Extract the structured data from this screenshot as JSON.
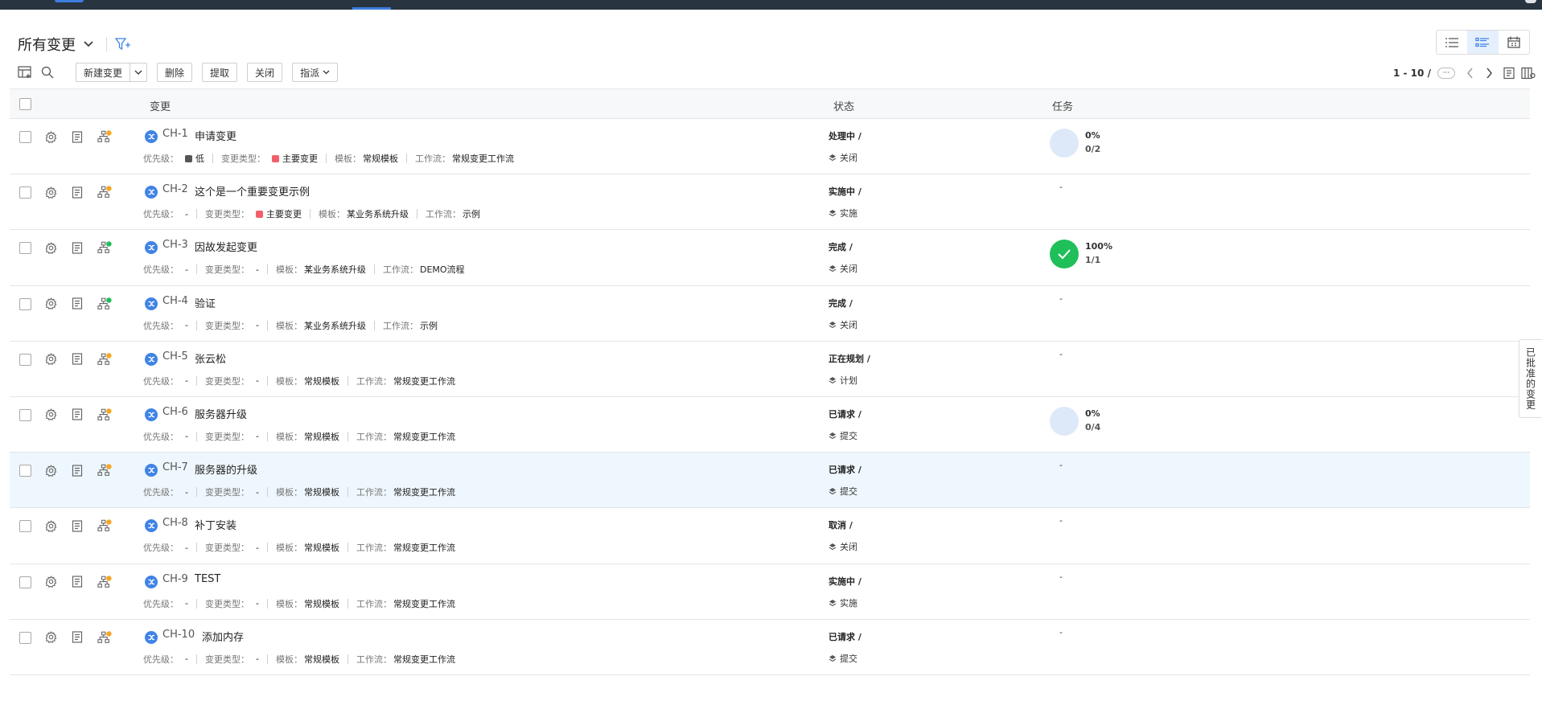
{
  "header": {
    "title": "所有变更"
  },
  "toolbar": {
    "new_label": "新建变更",
    "delete_label": "删除",
    "fetch_label": "提取",
    "close_label": "关闭",
    "assign_label": "指派"
  },
  "pager": {
    "range": "1 - 10 /",
    "more": "···"
  },
  "columns": {
    "change": "变更",
    "status": "状态",
    "task": "任务"
  },
  "labels": {
    "priority": "优先级：",
    "change_type": "变更类型：",
    "template": "模板：",
    "workflow": "工作流："
  },
  "side_tab": {
    "label": "已批准的变更"
  },
  "colors": {
    "accent": "#3f83e6",
    "badge_orange": "#f5a623",
    "badge_green": "#1fbf5a",
    "type_red": "#f0606a",
    "priority_low": "#555555",
    "highlight_row": "#eef7fd"
  },
  "rows": [
    {
      "id": "CH-1",
      "title": "申请变更",
      "priority": "低",
      "priority_color": "#555555",
      "change_type": "主要变更",
      "type_color": "#f0606a",
      "template": "常规模板",
      "workflow": "常规变更工作流",
      "stage": "处理中 /",
      "status": "关闭",
      "task_pct": "0%",
      "task_count": "0/2",
      "task_state": "progress",
      "badge": "orange"
    },
    {
      "id": "CH-2",
      "title": "这个是一个重要变更示例",
      "priority": "-",
      "priority_color": "",
      "change_type": "主要变更",
      "type_color": "#f0606a",
      "template": "某业务系统升级",
      "workflow": "示例",
      "stage": "实施中 /",
      "status": "实施",
      "task_pct": "",
      "task_count": "",
      "task_state": "none",
      "badge": "orange"
    },
    {
      "id": "CH-3",
      "title": "因故发起变更",
      "priority": "-",
      "priority_color": "",
      "change_type": "-",
      "type_color": "",
      "template": "某业务系统升级",
      "workflow": "DEMO流程",
      "stage": "完成 /",
      "status": "关闭",
      "task_pct": "100%",
      "task_count": "1/1",
      "task_state": "done",
      "badge": "green"
    },
    {
      "id": "CH-4",
      "title": "验证",
      "priority": "-",
      "priority_color": "",
      "change_type": "-",
      "type_color": "",
      "template": "某业务系统升级",
      "workflow": "示例",
      "stage": "完成 /",
      "status": "关闭",
      "task_pct": "",
      "task_count": "",
      "task_state": "none",
      "badge": "green"
    },
    {
      "id": "CH-5",
      "title": "张云松",
      "priority": "-",
      "priority_color": "",
      "change_type": "-",
      "type_color": "",
      "template": "常规模板",
      "workflow": "常规变更工作流",
      "stage": "正在规划 /",
      "status": "计划",
      "task_pct": "",
      "task_count": "",
      "task_state": "none",
      "badge": "orange"
    },
    {
      "id": "CH-6",
      "title": "服务器升级",
      "priority": "-",
      "priority_color": "",
      "change_type": "-",
      "type_color": "",
      "template": "常规模板",
      "workflow": "常规变更工作流",
      "stage": "已请求 /",
      "status": "提交",
      "task_pct": "0%",
      "task_count": "0/4",
      "task_state": "progress",
      "badge": "orange"
    },
    {
      "id": "CH-7",
      "title": "服务器的升级",
      "priority": "-",
      "priority_color": "",
      "change_type": "-",
      "type_color": "",
      "template": "常规模板",
      "workflow": "常规变更工作流",
      "stage": "已请求 /",
      "status": "提交",
      "task_pct": "",
      "task_count": "",
      "task_state": "none",
      "badge": "orange"
    },
    {
      "id": "CH-8",
      "title": "补丁安装",
      "priority": "-",
      "priority_color": "",
      "change_type": "-",
      "type_color": "",
      "template": "常规模板",
      "workflow": "常规变更工作流",
      "stage": "取消 /",
      "status": "关闭",
      "task_pct": "",
      "task_count": "",
      "task_state": "none",
      "badge": "orange"
    },
    {
      "id": "CH-9",
      "title": "TEST",
      "priority": "-",
      "priority_color": "",
      "change_type": "-",
      "type_color": "",
      "template": "常规模板",
      "workflow": "常规变更工作流",
      "stage": "实施中 /",
      "status": "实施",
      "task_pct": "",
      "task_count": "",
      "task_state": "none",
      "badge": "orange"
    },
    {
      "id": "CH-10",
      "title": "添加内存",
      "priority": "-",
      "priority_color": "",
      "change_type": "-",
      "type_color": "",
      "template": "常规模板",
      "workflow": "常规变更工作流",
      "stage": "已请求 /",
      "status": "提交",
      "task_pct": "",
      "task_count": "",
      "task_state": "none",
      "badge": "orange"
    }
  ]
}
